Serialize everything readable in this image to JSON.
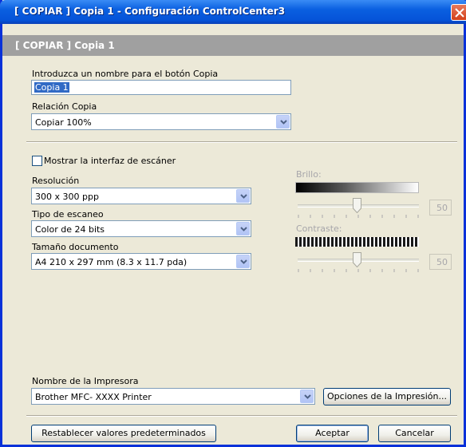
{
  "window": {
    "title": "[ COPIAR ]  Copia 1 - Configuración ControlCenter3"
  },
  "header": {
    "label": "[ COPIAR ]  Copia 1"
  },
  "button_name": {
    "label": "Introduzca un nombre para el botón Copia",
    "value": "Copia 1"
  },
  "copy_ratio": {
    "label": "Relación Copia",
    "value": "Copiar 100%"
  },
  "scanner_ui": {
    "label": "Mostrar la interfaz de escáner",
    "checked": false
  },
  "resolution": {
    "label": "Resolución",
    "value": "300 x 300 ppp"
  },
  "scan_type": {
    "label": "Tipo de escaneo",
    "value": "Color de 24 bits"
  },
  "doc_size": {
    "label": "Tamaño documento",
    "value": "A4 210 x 297 mm (8.3 x 11.7 pda)"
  },
  "brightness": {
    "label": "Brillo:",
    "value": "50",
    "level_percent": 50
  },
  "contrast": {
    "label": "Contraste:",
    "value": "50",
    "level_percent": 50
  },
  "printer": {
    "label": "Nombre de la Impresora",
    "value": "Brother MFC- XXXX Printer",
    "options_button": "Opciones de la Impresión..."
  },
  "buttons": {
    "reset": "Restablecer valores predeterminados",
    "ok": "Aceptar",
    "cancel": "Cancelar"
  },
  "colors": {
    "title_bar": "#0a5fe0",
    "header_strip": "#a0a0a0",
    "selection": "#316ac5",
    "close_button": "#d2401a"
  }
}
